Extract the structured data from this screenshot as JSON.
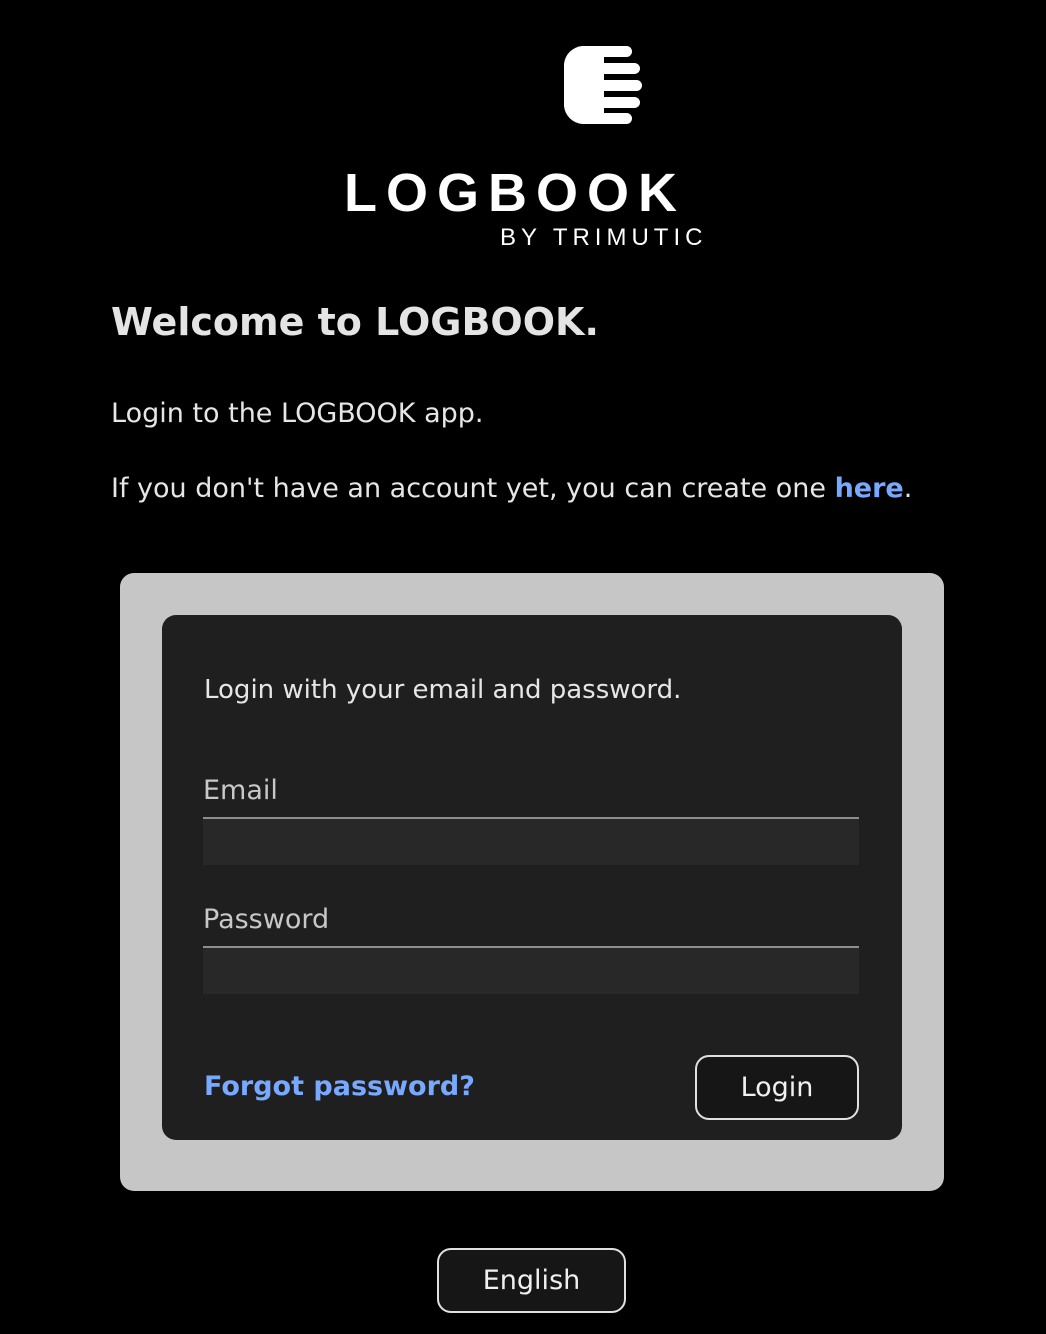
{
  "logo": {
    "wordmark": "LOGBOOK",
    "byline": "BY TRIMUTIC",
    "icon": "logbook-hand-icon"
  },
  "intro": {
    "heading": "Welcome to LOGBOOK.",
    "subtitle": "Login to the LOGBOOK app.",
    "signup_prefix": "If you don't have an account yet, you can create one ",
    "signup_link": "here",
    "signup_suffix": "."
  },
  "login_form": {
    "instructions": "Login with your email and password.",
    "email_label": "Email",
    "email_value": "",
    "password_label": "Password",
    "password_value": "",
    "forgot_password": "Forgot password?",
    "login_button": "Login"
  },
  "language": {
    "selected": "English"
  },
  "colors": {
    "background": "#000000",
    "link": "#78a9ff",
    "outer_card": "#c6c6c6",
    "inner_card": "#1f1f1f"
  }
}
